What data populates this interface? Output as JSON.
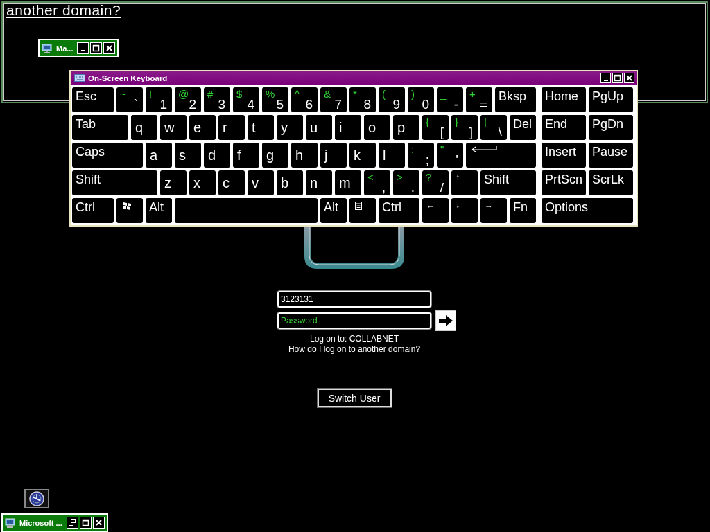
{
  "magnifier": {
    "text": "another domain?"
  },
  "minimized_window": {
    "title": "Ma..."
  },
  "keyboard": {
    "title": "On-Screen Keyboard",
    "main_rows": [
      [
        {
          "kind": "text",
          "label": "Esc"
        },
        {
          "kind": "dual",
          "shift": "~",
          "label": "`"
        },
        {
          "kind": "dual",
          "shift": "!",
          "label": "1"
        },
        {
          "kind": "dual",
          "shift": "@",
          "label": "2"
        },
        {
          "kind": "dual",
          "shift": "#",
          "label": "3"
        },
        {
          "kind": "dual",
          "shift": "$",
          "label": "4"
        },
        {
          "kind": "dual",
          "shift": "%",
          "label": "5"
        },
        {
          "kind": "dual",
          "shift": "^",
          "label": "6"
        },
        {
          "kind": "dual",
          "shift": "&",
          "label": "7"
        },
        {
          "kind": "dual",
          "shift": "*",
          "label": "8"
        },
        {
          "kind": "dual",
          "shift": "(",
          "label": "9"
        },
        {
          "kind": "dual",
          "shift": ")",
          "label": "0"
        },
        {
          "kind": "dual",
          "shift": "_",
          "label": "-"
        },
        {
          "kind": "dual",
          "shift": "+",
          "label": "="
        },
        {
          "kind": "text",
          "label": "Bksp"
        }
      ],
      [
        {
          "kind": "text",
          "label": "Tab"
        },
        {
          "kind": "letter",
          "label": "q"
        },
        {
          "kind": "letter",
          "label": "w"
        },
        {
          "kind": "letter",
          "label": "e"
        },
        {
          "kind": "letter",
          "label": "r"
        },
        {
          "kind": "letter",
          "label": "t"
        },
        {
          "kind": "letter",
          "label": "y"
        },
        {
          "kind": "letter",
          "label": "u"
        },
        {
          "kind": "letter",
          "label": "i"
        },
        {
          "kind": "letter",
          "label": "o"
        },
        {
          "kind": "letter",
          "label": "p"
        },
        {
          "kind": "dual",
          "shift": "{",
          "label": "["
        },
        {
          "kind": "dual",
          "shift": "}",
          "label": "]"
        },
        {
          "kind": "dual",
          "shift": "|",
          "label": "\\"
        },
        {
          "kind": "text",
          "label": "Del"
        }
      ],
      [
        {
          "kind": "text",
          "label": "Caps"
        },
        {
          "kind": "letter",
          "label": "a"
        },
        {
          "kind": "letter",
          "label": "s"
        },
        {
          "kind": "letter",
          "label": "d"
        },
        {
          "kind": "letter",
          "label": "f"
        },
        {
          "kind": "letter",
          "label": "g"
        },
        {
          "kind": "letter",
          "label": "h"
        },
        {
          "kind": "letter",
          "label": "j"
        },
        {
          "kind": "letter",
          "label": "k"
        },
        {
          "kind": "letter",
          "label": "l"
        },
        {
          "kind": "dual",
          "shift": ":",
          "label": ";"
        },
        {
          "kind": "dual",
          "shift": "\"",
          "label": "'"
        },
        {
          "kind": "enter"
        }
      ],
      [
        {
          "kind": "text",
          "label": "Shift"
        },
        {
          "kind": "letter",
          "label": "z"
        },
        {
          "kind": "letter",
          "label": "x"
        },
        {
          "kind": "letter",
          "label": "c"
        },
        {
          "kind": "letter",
          "label": "v"
        },
        {
          "kind": "letter",
          "label": "b"
        },
        {
          "kind": "letter",
          "label": "n"
        },
        {
          "kind": "letter",
          "label": "m"
        },
        {
          "kind": "dual",
          "shift": "<",
          "label": ","
        },
        {
          "kind": "dual",
          "shift": ">",
          "label": "."
        },
        {
          "kind": "dual",
          "shift": "?",
          "label": "/"
        },
        {
          "kind": "small",
          "label": "↑"
        },
        {
          "kind": "text",
          "label": "Shift"
        }
      ],
      [
        {
          "kind": "text",
          "label": "Ctrl"
        },
        {
          "kind": "windows"
        },
        {
          "kind": "text",
          "label": "Alt"
        },
        {
          "kind": "space"
        },
        {
          "kind": "text",
          "label": "Alt"
        },
        {
          "kind": "menu"
        },
        {
          "kind": "text",
          "label": "Ctrl"
        },
        {
          "kind": "small",
          "label": "←"
        },
        {
          "kind": "small",
          "label": "↓"
        },
        {
          "kind": "small",
          "label": "→"
        },
        {
          "kind": "text",
          "label": "Fn"
        }
      ]
    ],
    "nav_rows": [
      [
        {
          "kind": "text",
          "label": "Home"
        },
        {
          "kind": "text",
          "label": "PgUp"
        }
      ],
      [
        {
          "kind": "text",
          "label": "End"
        },
        {
          "kind": "text",
          "label": "PgDn"
        }
      ],
      [
        {
          "kind": "text",
          "label": "Insert"
        },
        {
          "kind": "text",
          "label": "Pause"
        }
      ],
      [
        {
          "kind": "text",
          "label": "PrtScn"
        },
        {
          "kind": "text",
          "label": "ScrLk"
        }
      ],
      [
        {
          "kind": "text",
          "label": "Options"
        }
      ]
    ]
  },
  "login": {
    "username": {
      "value": "3123131"
    },
    "password": {
      "placeholder": "Password"
    },
    "domain_label": "Log on to: COLLABNET",
    "help_link": "How do I log on to another domain?",
    "switch_user": "Switch User"
  },
  "taskbar_window": {
    "title": "Microsoft ..."
  }
}
